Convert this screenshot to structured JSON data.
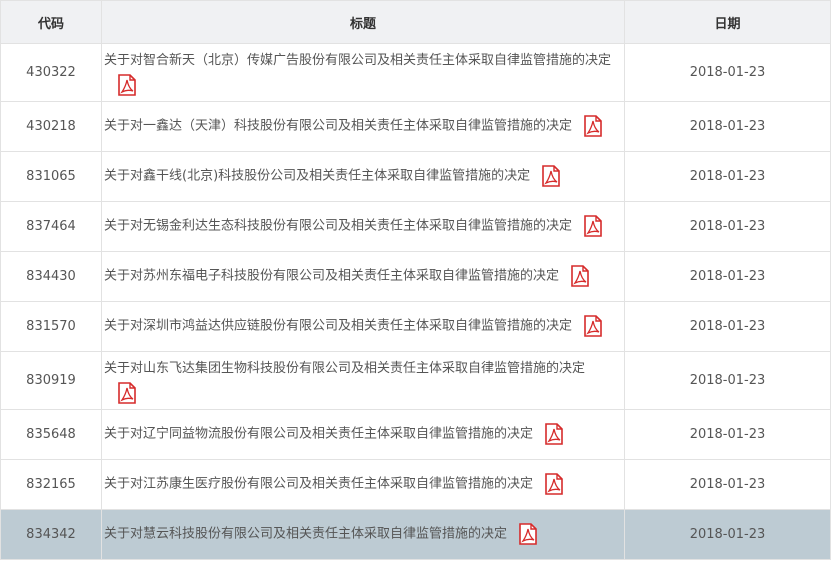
{
  "table": {
    "headers": {
      "code": "代码",
      "title": "标题",
      "date": "日期"
    },
    "rows": [
      {
        "code": "430322",
        "title": "关于对智合新天（北京）传媒广告股份有限公司及相关责任主体采取自律监管措施的决定",
        "date": "2018-01-23",
        "icon": "pdf-icon"
      },
      {
        "code": "430218",
        "title": "关于对一鑫达（天津）科技股份有限公司及相关责任主体采取自律监管措施的决定",
        "date": "2018-01-23",
        "icon": "pdf-icon"
      },
      {
        "code": "831065",
        "title": "关于对鑫干线(北京)科技股份公司及相关责任主体采取自律监管措施的决定",
        "date": "2018-01-23",
        "icon": "pdf-icon"
      },
      {
        "code": "837464",
        "title": "关于对无锡金利达生态科技股份有限公司及相关责任主体采取自律监管措施的决定",
        "date": "2018-01-23",
        "icon": "pdf-icon"
      },
      {
        "code": "834430",
        "title": "关于对苏州东福电子科技股份有限公司及相关责任主体采取自律监管措施的决定",
        "date": "2018-01-23",
        "icon": "pdf-icon"
      },
      {
        "code": "831570",
        "title": "关于对深圳市鸿益达供应链股份有限公司及相关责任主体采取自律监管措施的决定",
        "date": "2018-01-23",
        "icon": "pdf-icon"
      },
      {
        "code": "830919",
        "title": "关于对山东飞达集团生物科技股份有限公司及相关责任主体采取自律监管措施的决定",
        "date": "2018-01-23",
        "icon": "pdf-icon"
      },
      {
        "code": "835648",
        "title": "关于对辽宁同益物流股份有限公司及相关责任主体采取自律监管措施的决定",
        "date": "2018-01-23",
        "icon": "pdf-icon"
      },
      {
        "code": "832165",
        "title": "关于对江苏康生医疗股份有限公司及相关责任主体采取自律监管措施的决定",
        "date": "2018-01-23",
        "icon": "pdf-icon"
      },
      {
        "code": "834342",
        "title": "关于对慧云科技股份有限公司及相关责任主体采取自律监管措施的决定",
        "date": "2018-01-23",
        "icon": "pdf-icon",
        "selected": true
      }
    ]
  },
  "colors": {
    "header_bg": "#f0f1f3",
    "selected_row_bg": "#bdcbd3",
    "pdf_red": "#d62b2b"
  }
}
